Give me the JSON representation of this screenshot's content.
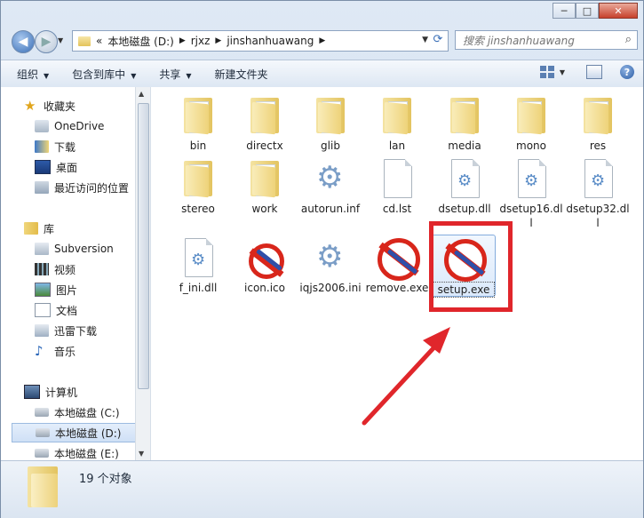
{
  "window": {
    "caption_buttons": [
      "─",
      "□",
      "✕"
    ]
  },
  "address": {
    "overflow": "«",
    "crumbs": [
      "本地磁盘 (D:)",
      "rjxz",
      "jinshanhuawang"
    ],
    "search_placeholder": "搜索 jinshanhuawang"
  },
  "toolbar": {
    "organize": "组织",
    "include_library": "包含到库中",
    "share": "共享",
    "new_folder": "新建文件夹"
  },
  "sidebar": {
    "items": [
      {
        "label": "收藏夹",
        "icon": "star-icon"
      },
      {
        "label": "OneDrive",
        "icon": "onedrive-icon"
      },
      {
        "label": "下载",
        "icon": "download-folder-icon"
      },
      {
        "label": "桌面",
        "icon": "desktop-icon"
      },
      {
        "label": "最近访问的位置",
        "icon": "recent-places-icon"
      },
      {
        "label": "库",
        "icon": "library-icon"
      },
      {
        "label": "Subversion",
        "icon": "subversion-icon"
      },
      {
        "label": "视频",
        "icon": "video-icon"
      },
      {
        "label": "图片",
        "icon": "pictures-icon"
      },
      {
        "label": "文档",
        "icon": "documents-icon"
      },
      {
        "label": "迅雷下载",
        "icon": "thunder-download-icon"
      },
      {
        "label": "音乐",
        "icon": "music-icon"
      },
      {
        "label": "计算机",
        "icon": "computer-icon"
      },
      {
        "label": "本地磁盘 (C:)",
        "icon": "drive-icon"
      },
      {
        "label": "本地磁盘 (D:)",
        "icon": "drive-icon"
      },
      {
        "label": "本地磁盘 (E:)",
        "icon": "drive-icon"
      }
    ]
  },
  "files": [
    {
      "name": "bin",
      "type": "folder"
    },
    {
      "name": "directx",
      "type": "folder"
    },
    {
      "name": "glib",
      "type": "folder"
    },
    {
      "name": "lan",
      "type": "folder"
    },
    {
      "name": "media",
      "type": "folder"
    },
    {
      "name": "mono",
      "type": "folder"
    },
    {
      "name": "res",
      "type": "folder"
    },
    {
      "name": "stereo",
      "type": "folder"
    },
    {
      "name": "work",
      "type": "folder"
    },
    {
      "name": "autorun.inf",
      "type": "settings"
    },
    {
      "name": "cd.lst",
      "type": "file"
    },
    {
      "name": "dsetup.dll",
      "type": "dll"
    },
    {
      "name": "dsetup16.dll",
      "type": "dll"
    },
    {
      "name": "dsetup32.dll",
      "type": "dll"
    },
    {
      "name": "f_ini.dll",
      "type": "dll"
    },
    {
      "name": "icon.ico",
      "type": "exe-small"
    },
    {
      "name": "iqjs2006.ini",
      "type": "settings"
    },
    {
      "name": "remove.exe",
      "type": "exe"
    },
    {
      "name": "setup.exe",
      "type": "exe"
    }
  ],
  "status": {
    "count": "19 个对象"
  },
  "colors": {
    "annotation": "#e0262b",
    "selection": "#cfe0f6"
  }
}
